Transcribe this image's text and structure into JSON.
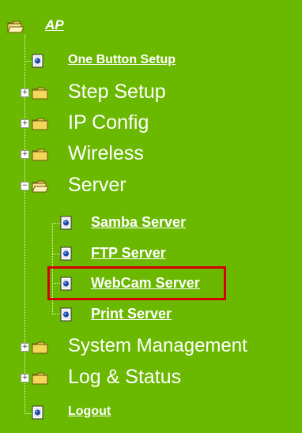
{
  "root": {
    "label": "AP"
  },
  "items": [
    {
      "label": "One Button Setup"
    },
    {
      "label": "Step Setup"
    },
    {
      "label": "IP Config"
    },
    {
      "label": "Wireless"
    },
    {
      "label": "Server"
    },
    {
      "label": "Samba Server"
    },
    {
      "label": "FTP Server"
    },
    {
      "label": "WebCam Server"
    },
    {
      "label": "Print Server"
    },
    {
      "label": "System Management"
    },
    {
      "label": "Log & Status"
    },
    {
      "label": "Logout"
    }
  ],
  "selected_item": "WebCam Server",
  "colors": {
    "background": "#6bb800",
    "text": "#ffffff",
    "folder": "#f2d75a",
    "highlight": "#d40000",
    "page_icon_dot": "#1b47a8"
  },
  "icons": {
    "closed_folder": "folder-icon",
    "open_folder": "open-folder-icon",
    "page": "page-icon",
    "expand": "plus-icon",
    "collapse": "minus-icon"
  }
}
